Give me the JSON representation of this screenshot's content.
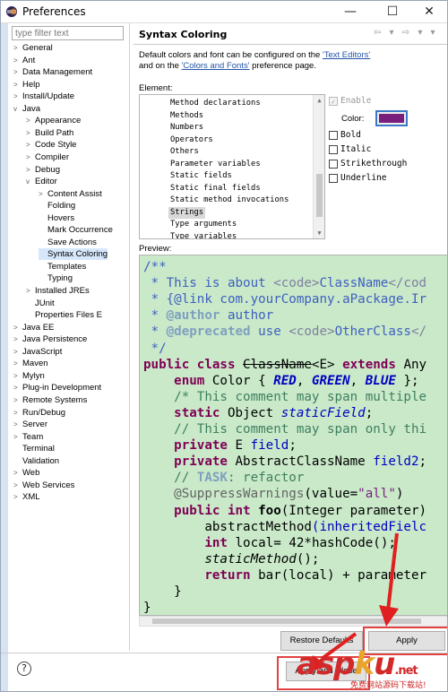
{
  "window": {
    "title": "Preferences",
    "minimize": "—",
    "maximize": "☐",
    "close": "✕"
  },
  "filter": {
    "placeholder": "type filter text"
  },
  "tree": [
    {
      "label": "General",
      "depth": 0,
      "arrow": ">"
    },
    {
      "label": "Ant",
      "depth": 0,
      "arrow": ">"
    },
    {
      "label": "Data Management",
      "depth": 0,
      "arrow": ">"
    },
    {
      "label": "Help",
      "depth": 0,
      "arrow": ">"
    },
    {
      "label": "Install/Update",
      "depth": 0,
      "arrow": ">"
    },
    {
      "label": "Java",
      "depth": 0,
      "arrow": "v"
    },
    {
      "label": "Appearance",
      "depth": 1,
      "arrow": ">"
    },
    {
      "label": "Build Path",
      "depth": 1,
      "arrow": ">"
    },
    {
      "label": "Code Style",
      "depth": 1,
      "arrow": ">"
    },
    {
      "label": "Compiler",
      "depth": 1,
      "arrow": ">"
    },
    {
      "label": "Debug",
      "depth": 1,
      "arrow": ">"
    },
    {
      "label": "Editor",
      "depth": 1,
      "arrow": "v"
    },
    {
      "label": "Content Assist",
      "depth": 2,
      "arrow": ">"
    },
    {
      "label": "Folding",
      "depth": 2,
      "arrow": ""
    },
    {
      "label": "Hovers",
      "depth": 2,
      "arrow": ""
    },
    {
      "label": "Mark Occurrence",
      "depth": 2,
      "arrow": ""
    },
    {
      "label": "Save Actions",
      "depth": 2,
      "arrow": ""
    },
    {
      "label": "Syntax Coloring",
      "depth": 2,
      "arrow": "",
      "selected": true
    },
    {
      "label": "Templates",
      "depth": 2,
      "arrow": ""
    },
    {
      "label": "Typing",
      "depth": 2,
      "arrow": ""
    },
    {
      "label": "Installed JREs",
      "depth": 1,
      "arrow": ">"
    },
    {
      "label": "JUnit",
      "depth": 1,
      "arrow": ""
    },
    {
      "label": "Properties Files E",
      "depth": 1,
      "arrow": ""
    },
    {
      "label": "Java EE",
      "depth": 0,
      "arrow": ">"
    },
    {
      "label": "Java Persistence",
      "depth": 0,
      "arrow": ">"
    },
    {
      "label": "JavaScript",
      "depth": 0,
      "arrow": ">"
    },
    {
      "label": "Maven",
      "depth": 0,
      "arrow": ">"
    },
    {
      "label": "Mylyn",
      "depth": 0,
      "arrow": ">"
    },
    {
      "label": "Plug-in Development",
      "depth": 0,
      "arrow": ">"
    },
    {
      "label": "Remote Systems",
      "depth": 0,
      "arrow": ">"
    },
    {
      "label": "Run/Debug",
      "depth": 0,
      "arrow": ">"
    },
    {
      "label": "Server",
      "depth": 0,
      "arrow": ">"
    },
    {
      "label": "Team",
      "depth": 0,
      "arrow": ">"
    },
    {
      "label": "Terminal",
      "depth": 0,
      "arrow": ""
    },
    {
      "label": "Validation",
      "depth": 0,
      "arrow": ""
    },
    {
      "label": "Web",
      "depth": 0,
      "arrow": ">"
    },
    {
      "label": "Web Services",
      "depth": 0,
      "arrow": ">"
    },
    {
      "label": "XML",
      "depth": 0,
      "arrow": ">"
    }
  ],
  "page": {
    "title": "Syntax Coloring",
    "nav": "⇦ ▾ ⇨ ▾ ▾",
    "desc_1": "Default colors and font can be configured on the ",
    "desc_link1": "'Text Editors'",
    "desc_2": "and on the ",
    "desc_link2": "'Colors and Fonts'",
    "desc_3": " preference page.",
    "element_label": "Element:",
    "preview_label": "Preview:"
  },
  "elements": [
    {
      "label": "Method declarations"
    },
    {
      "label": "Methods"
    },
    {
      "label": "Numbers"
    },
    {
      "label": "Operators"
    },
    {
      "label": "Others"
    },
    {
      "label": "Parameter variables"
    },
    {
      "label": "Static fields"
    },
    {
      "label": "Static final fields"
    },
    {
      "label": "Static method invocations"
    },
    {
      "label": "Strings",
      "selected": true
    },
    {
      "label": "Type arguments"
    },
    {
      "label": "Type variables"
    }
  ],
  "options": {
    "enable": "Enable",
    "enable_checked": "✓",
    "color_label": "Color:",
    "color_value": "#7a1e7e",
    "bold": "Bold",
    "italic": "Italic",
    "strikethrough": "Strikethrough",
    "underline": "Underline"
  },
  "preview": {
    "lines": [
      [
        {
          "t": "/**",
          "c": "#3f5fbf"
        }
      ],
      [
        {
          "t": " * This is about ",
          "c": "#3f5fbf"
        },
        {
          "t": "<code>",
          "c": "#7f7f9f"
        },
        {
          "t": "ClassName",
          "c": "#3f5fbf"
        },
        {
          "t": "</cod",
          "c": "#7f7f9f"
        }
      ],
      [
        {
          "t": " * {@link ",
          "c": "#3f5fbf"
        },
        {
          "t": "com.yourCompany.aPackage.Ir",
          "c": "#3f5fbf"
        }
      ],
      [
        {
          "t": " * ",
          "c": "#3f5fbf"
        },
        {
          "t": "@author",
          "c": "#7f9fbf",
          "b": true
        },
        {
          "t": " author",
          "c": "#3f5fbf"
        }
      ],
      [
        {
          "t": " * ",
          "c": "#3f5fbf"
        },
        {
          "t": "@deprecated",
          "c": "#7f9fbf",
          "b": true
        },
        {
          "t": " use ",
          "c": "#3f5fbf"
        },
        {
          "t": "<code>",
          "c": "#7f7f9f"
        },
        {
          "t": "OtherClass",
          "c": "#3f5fbf"
        },
        {
          "t": "</",
          "c": "#7f7f9f"
        }
      ],
      [
        {
          "t": " */",
          "c": "#3f5fbf"
        }
      ],
      [
        {
          "t": "public class ",
          "c": "#7f0055",
          "b": true
        },
        {
          "t": "ClassName",
          "c": "#000",
          "s": true
        },
        {
          "t": "<E> ",
          "c": "#000"
        },
        {
          "t": "extends ",
          "c": "#7f0055",
          "b": true
        },
        {
          "t": "Any",
          "c": "#000"
        }
      ],
      [
        {
          "t": "    enum ",
          "c": "#7f0055",
          "b": true
        },
        {
          "t": "Color { ",
          "c": "#000"
        },
        {
          "t": "RED",
          "c": "#0000c0",
          "i": true,
          "b": true
        },
        {
          "t": ", ",
          "c": "#000"
        },
        {
          "t": "GREEN",
          "c": "#0000c0",
          "i": true,
          "b": true
        },
        {
          "t": ", ",
          "c": "#000"
        },
        {
          "t": "BLUE",
          "c": "#0000c0",
          "i": true,
          "b": true
        },
        {
          "t": " };",
          "c": "#000"
        }
      ],
      [
        {
          "t": "    /* This comment may span multiple",
          "c": "#3f7f5f"
        }
      ],
      [
        {
          "t": "    static ",
          "c": "#7f0055",
          "b": true
        },
        {
          "t": "Object ",
          "c": "#000"
        },
        {
          "t": "staticField",
          "c": "#0000c0",
          "i": true
        },
        {
          "t": ";",
          "c": "#000"
        }
      ],
      [
        {
          "t": "    // This comment may span only thi",
          "c": "#3f7f5f"
        }
      ],
      [
        {
          "t": "    private ",
          "c": "#7f0055",
          "b": true
        },
        {
          "t": "E ",
          "c": "#000"
        },
        {
          "t": "field",
          "c": "#0000c0"
        },
        {
          "t": ";",
          "c": "#000"
        }
      ],
      [
        {
          "t": "    private ",
          "c": "#7f0055",
          "b": true
        },
        {
          "t": "AbstractClassName ",
          "c": "#000"
        },
        {
          "t": "field2",
          "c": "#0000c0"
        },
        {
          "t": ";",
          "c": "#000"
        }
      ],
      [
        {
          "t": "    // ",
          "c": "#3f7f5f"
        },
        {
          "t": "TASK",
          "c": "#7f9fbf",
          "b": true
        },
        {
          "t": ": refactor",
          "c": "#3f7f5f"
        }
      ],
      [
        {
          "t": "    @SuppressWarnings",
          "c": "#646464"
        },
        {
          "t": "(value=",
          "c": "#000"
        },
        {
          "t": "\"all\"",
          "c": "#7a1e7e"
        },
        {
          "t": ")",
          "c": "#000"
        }
      ],
      [
        {
          "t": "    public int ",
          "c": "#7f0055",
          "b": true
        },
        {
          "t": "foo",
          "c": "#000",
          "b": true
        },
        {
          "t": "(Integer ",
          "c": "#000"
        },
        {
          "t": "parameter",
          "c": "#000"
        },
        {
          "t": ")",
          "c": "#000"
        }
      ],
      [
        {
          "t": "        abstractMethod",
          "c": "#000"
        },
        {
          "t": "(inheritedFielc",
          "c": "#0000c0"
        }
      ],
      [
        {
          "t": "        int ",
          "c": "#7f0055",
          "b": true
        },
        {
          "t": "local",
          "c": "#000"
        },
        {
          "t": "= ",
          "c": "#000"
        },
        {
          "t": "42",
          "c": "#000"
        },
        {
          "t": "*hashCode();",
          "c": "#000"
        }
      ],
      [
        {
          "t": "        staticMethod",
          "c": "#000",
          "i": true
        },
        {
          "t": "();",
          "c": "#000"
        }
      ],
      [
        {
          "t": "        return ",
          "c": "#7f0055",
          "b": true
        },
        {
          "t": "bar",
          "c": "#000"
        },
        {
          "t": "(local) + parameter",
          "c": "#000"
        }
      ],
      [
        {
          "t": "    }",
          "c": "#000"
        }
      ],
      [
        {
          "t": "}",
          "c": "#000"
        }
      ]
    ]
  },
  "buttons": {
    "restore_defaults": "Restore Defaults",
    "apply": "Apply",
    "apply_and_close": "Apply and Close",
    "help": "?"
  },
  "watermark": {
    "main": "asp",
    "dot": "k",
    "rest": "u",
    "tld": ".net",
    "sub": "免费网站源码下载站!"
  }
}
